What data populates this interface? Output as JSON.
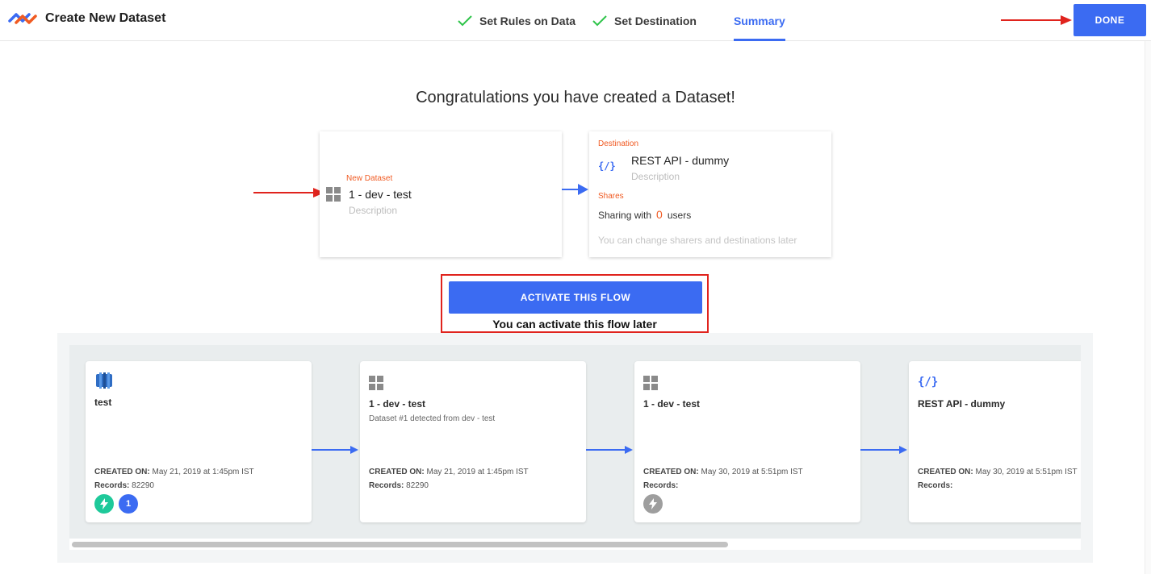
{
  "header": {
    "app_title": "Create New Dataset",
    "steps": [
      {
        "label": "Set Rules on Data",
        "completed": true
      },
      {
        "label": "Set Destination",
        "completed": true
      },
      {
        "label": "Summary",
        "active": true
      }
    ],
    "done_label": "DONE"
  },
  "summary": {
    "heading": "Congratulations you have created a Dataset!",
    "dataset_card": {
      "label": "New Dataset",
      "name": "1 - dev - test",
      "description": "Description",
      "icon": "grid-icon"
    },
    "destination_card": {
      "label": "Destination",
      "icon_text": "{/}",
      "name": "REST API - dummy",
      "description": "Description",
      "shares_label": "Shares",
      "sharing_prefix": "Sharing with",
      "sharing_count": "0",
      "sharing_suffix": "users",
      "change_note": "You can change sharers and destinations later"
    },
    "activate_label": "ACTIVATE THIS FLOW",
    "activate_note": "You can activate this flow later"
  },
  "flow": {
    "cards": [
      {
        "icon": "database-icon",
        "name": "test",
        "subtitle": "",
        "created_label": "CREATED ON:",
        "created_value": "May 21, 2019 at 1:45pm IST",
        "records_label": "Records:",
        "records_value": "82290",
        "badges": [
          "bolt-badge",
          "1"
        ]
      },
      {
        "icon": "grid-icon",
        "name": "1 - dev - test",
        "subtitle": "Dataset #1 detected from dev - test",
        "created_label": "CREATED ON:",
        "created_value": "May 21, 2019 at 1:45pm IST",
        "records_label": "Records:",
        "records_value": "82290"
      },
      {
        "icon": "grid-icon",
        "name": "1 - dev - test",
        "subtitle": "",
        "created_label": "CREATED ON:",
        "created_value": "May 30, 2019 at 5:51pm IST",
        "records_label": "Records:",
        "records_value": "",
        "badges": [
          "bolt-badge-grey"
        ]
      },
      {
        "icon": "code-icon",
        "icon_text": "{/}",
        "name": "REST API - dummy",
        "subtitle": "",
        "created_label": "CREATED ON:",
        "created_value": "May 30, 2019 at 5:51pm IST",
        "records_label": "Records:",
        "records_value": ""
      }
    ],
    "badge_count": "1"
  },
  "colors": {
    "accent": "#3b6bf2",
    "orange": "#f05a22",
    "annotation_red": "#e0231d",
    "green_check": "#2ec44a",
    "teal_badge": "#1ec99a"
  }
}
